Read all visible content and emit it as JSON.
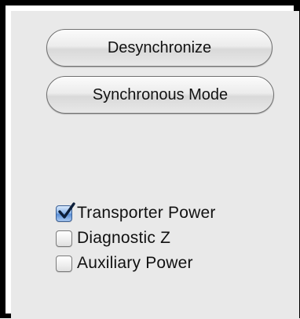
{
  "buttons": {
    "desynchronize_label": "Desynchronize",
    "synchronous_mode_label": "Synchronous Mode"
  },
  "checkboxes": [
    {
      "label": "Transporter Power",
      "checked": true
    },
    {
      "label": "Diagnostic Z",
      "checked": false
    },
    {
      "label": "Auxiliary Power",
      "checked": false
    }
  ],
  "colors": {
    "frame": "#000000",
    "panel_background": "#e9e9e9",
    "checkbox_accent": "#5a8fd6"
  },
  "icons": {
    "check": "checkmark-icon"
  }
}
